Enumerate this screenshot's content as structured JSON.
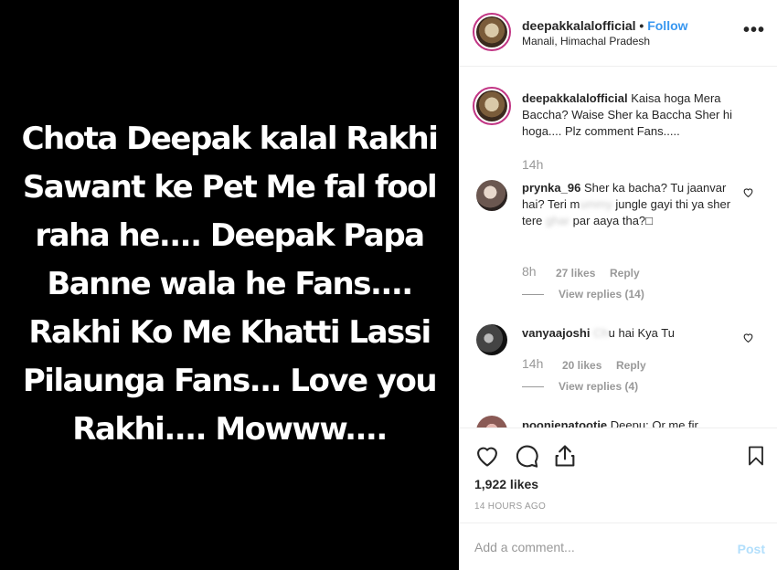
{
  "media": {
    "text": "Chota Deepak kalal Rakhi Sawant ke Pet Me fal fool raha he.... Deepak Papa Banne wala he Fans.... Rakhi Ko Me Khatti Lassi Pilaunga Fans... Love you Rakhi.... Mowww...."
  },
  "header": {
    "username": "deepakkalalofficial",
    "dot": "•",
    "follow": "Follow",
    "location": "Manali, Himachal Pradesh",
    "more": "•••"
  },
  "caption": {
    "username": "deepakkalalofficial",
    "text": "Kaisa hoga Mera Baccha? Waise Sher ka Baccha Sher hi hoga.... Plz comment Fans.....",
    "time": "14h"
  },
  "comments": [
    {
      "username": "prynka_96",
      "text": "Sher ka bacha? Tu jaanvar hai? Teri m",
      "text_blurred": "ummy",
      "text_rest": " jungle gayi thi ya sher tere ",
      "text_blurred2": "ghar",
      "text_rest2": " par aaya tha?□",
      "time": "8h",
      "likes": "27 likes",
      "reply": "Reply",
      "view_replies": "View replies (14)"
    },
    {
      "username": "vanyaajoshi",
      "text_blurred": " Ch",
      "text": "u hai Kya Tu",
      "time": "14h",
      "likes": "20 likes",
      "reply": "Reply",
      "view_replies": "View replies (4)"
    },
    {
      "username": "poonienatootie",
      "text": "Deepu: Or me fir"
    }
  ],
  "actions": {
    "likes": "1,922 likes",
    "posted_ago": "14 HOURS AGO"
  },
  "comment_box": {
    "placeholder": "Add a comment...",
    "post": "Post"
  }
}
